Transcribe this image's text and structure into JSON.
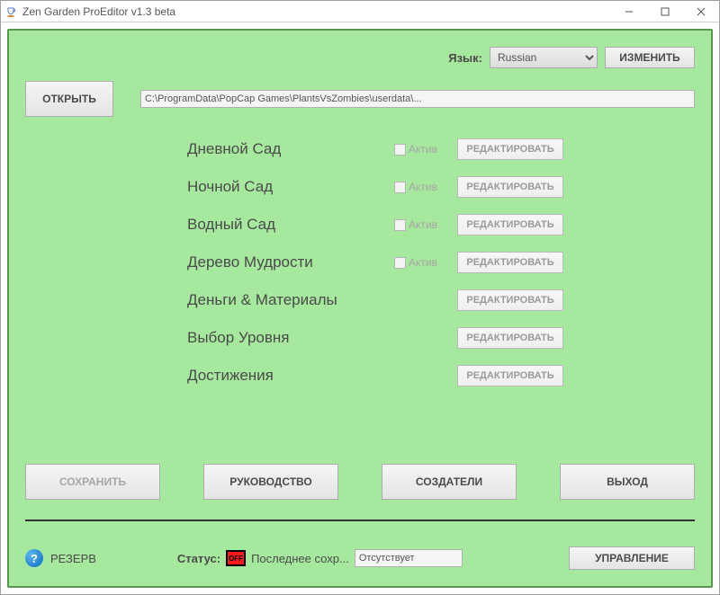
{
  "window": {
    "title": "Zen Garden ProEditor v1.3 beta"
  },
  "lang": {
    "label": "Язык:",
    "selected": "Russian",
    "change_button": "ИЗМЕНИТЬ"
  },
  "open": {
    "button": "ОТКРЫТЬ",
    "path": "C:\\ProgramData\\PopCap Games\\PlantsVsZombies\\userdata\\..."
  },
  "sections": [
    {
      "title": "Дневной Сад",
      "has_active": true,
      "active_label": "Актив",
      "edit_label": "РЕДАКТИРОВАТЬ"
    },
    {
      "title": "Ночной Сад",
      "has_active": true,
      "active_label": "Актив",
      "edit_label": "РЕДАКТИРОВАТЬ"
    },
    {
      "title": "Водный Сад",
      "has_active": true,
      "active_label": "Актив",
      "edit_label": "РЕДАКТИРОВАТЬ"
    },
    {
      "title": "Дерево Мудрости",
      "has_active": true,
      "active_label": "Актив",
      "edit_label": "РЕДАКТИРОВАТЬ"
    },
    {
      "title": "Деньги & Материалы",
      "has_active": false,
      "active_label": "",
      "edit_label": "РЕДАКТИРОВАТЬ"
    },
    {
      "title": "Выбор Уровня",
      "has_active": false,
      "active_label": "",
      "edit_label": "РЕДАКТИРОВАТЬ"
    },
    {
      "title": "Достижения",
      "has_active": false,
      "active_label": "",
      "edit_label": "РЕДАКТИРОВАТЬ"
    }
  ],
  "bottom": {
    "save": "СОХРАНИТЬ",
    "guide": "РУКОВОДСТВО",
    "creators": "СОЗДАТЕЛИ",
    "exit": "ВЫХОД"
  },
  "status": {
    "reserve": "РЕЗЕРВ",
    "status_label": "Статус:",
    "status_value": "OFF",
    "last_save_label": "Последнее сохр...",
    "last_save_value": "Отсутствует",
    "manage_button": "УПРАВЛЕНИЕ"
  }
}
